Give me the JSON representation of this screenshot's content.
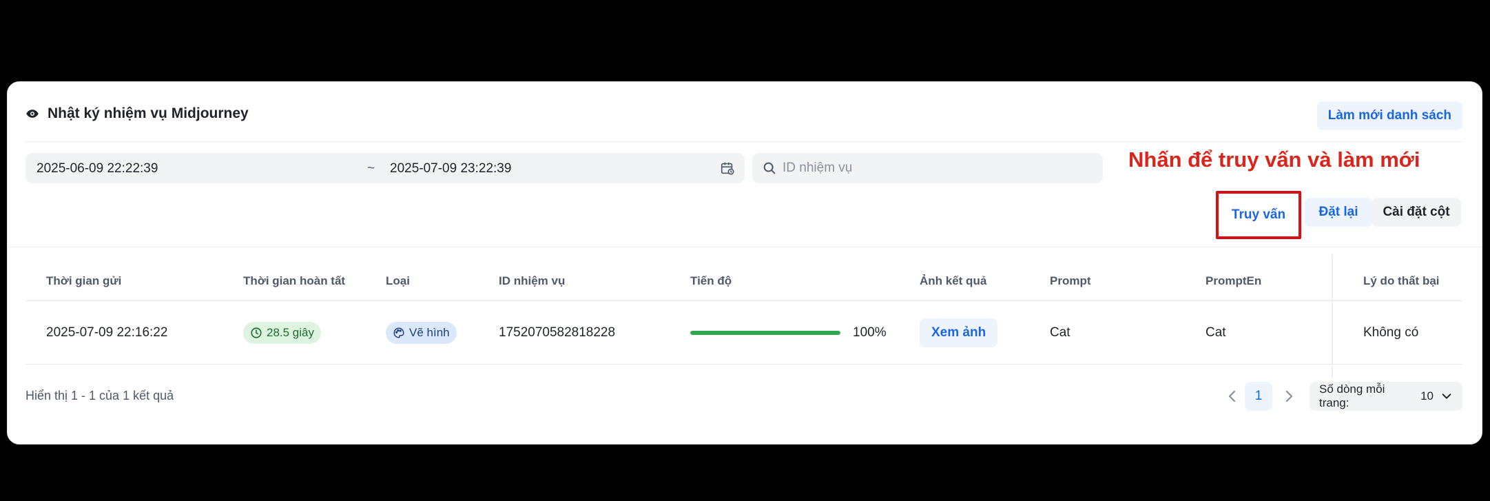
{
  "header": {
    "title": "Nhật ký nhiệm vụ Midjourney",
    "refresh_label": "Làm mới danh sách"
  },
  "filters": {
    "date_start": "2025-06-09 22:22:39",
    "date_separator": "~",
    "date_end": "2025-07-09 23:22:39",
    "search_placeholder": "ID nhiệm vụ",
    "search_value": ""
  },
  "annotation": "Nhấn để truy vấn và làm mới",
  "actions": {
    "query_label": "Truy vấn",
    "reset_label": "Đặt lại",
    "columns_label": "Cài đặt cột"
  },
  "table": {
    "columns": [
      "Thời gian gửi",
      "Thời gian hoàn tất",
      "Loại",
      "ID nhiệm vụ",
      "Tiến độ",
      "Ảnh kết quả",
      "Prompt",
      "PromptEn",
      "Lý do thất bại"
    ],
    "rows": [
      {
        "submit_time": "2025-07-09 22:16:22",
        "duration": "28.5 giây",
        "type": "Vẽ hình",
        "task_id": "1752070582818228",
        "progress_text": "100%",
        "progress_fraction": 1.0,
        "view_label": "Xem ảnh",
        "prompt": "Cat",
        "prompt_en": "Cat",
        "fail_reason": "Không có"
      }
    ]
  },
  "footer": {
    "summary": "Hiển thị 1 - 1 của 1 kết quả",
    "current_page": "1",
    "page_size_label": "Số dòng mỗi trang:",
    "page_size_value": "10"
  },
  "colors": {
    "accent": "#1a66e0",
    "annotation": "#d9251c",
    "progress": "#2fa84f"
  }
}
